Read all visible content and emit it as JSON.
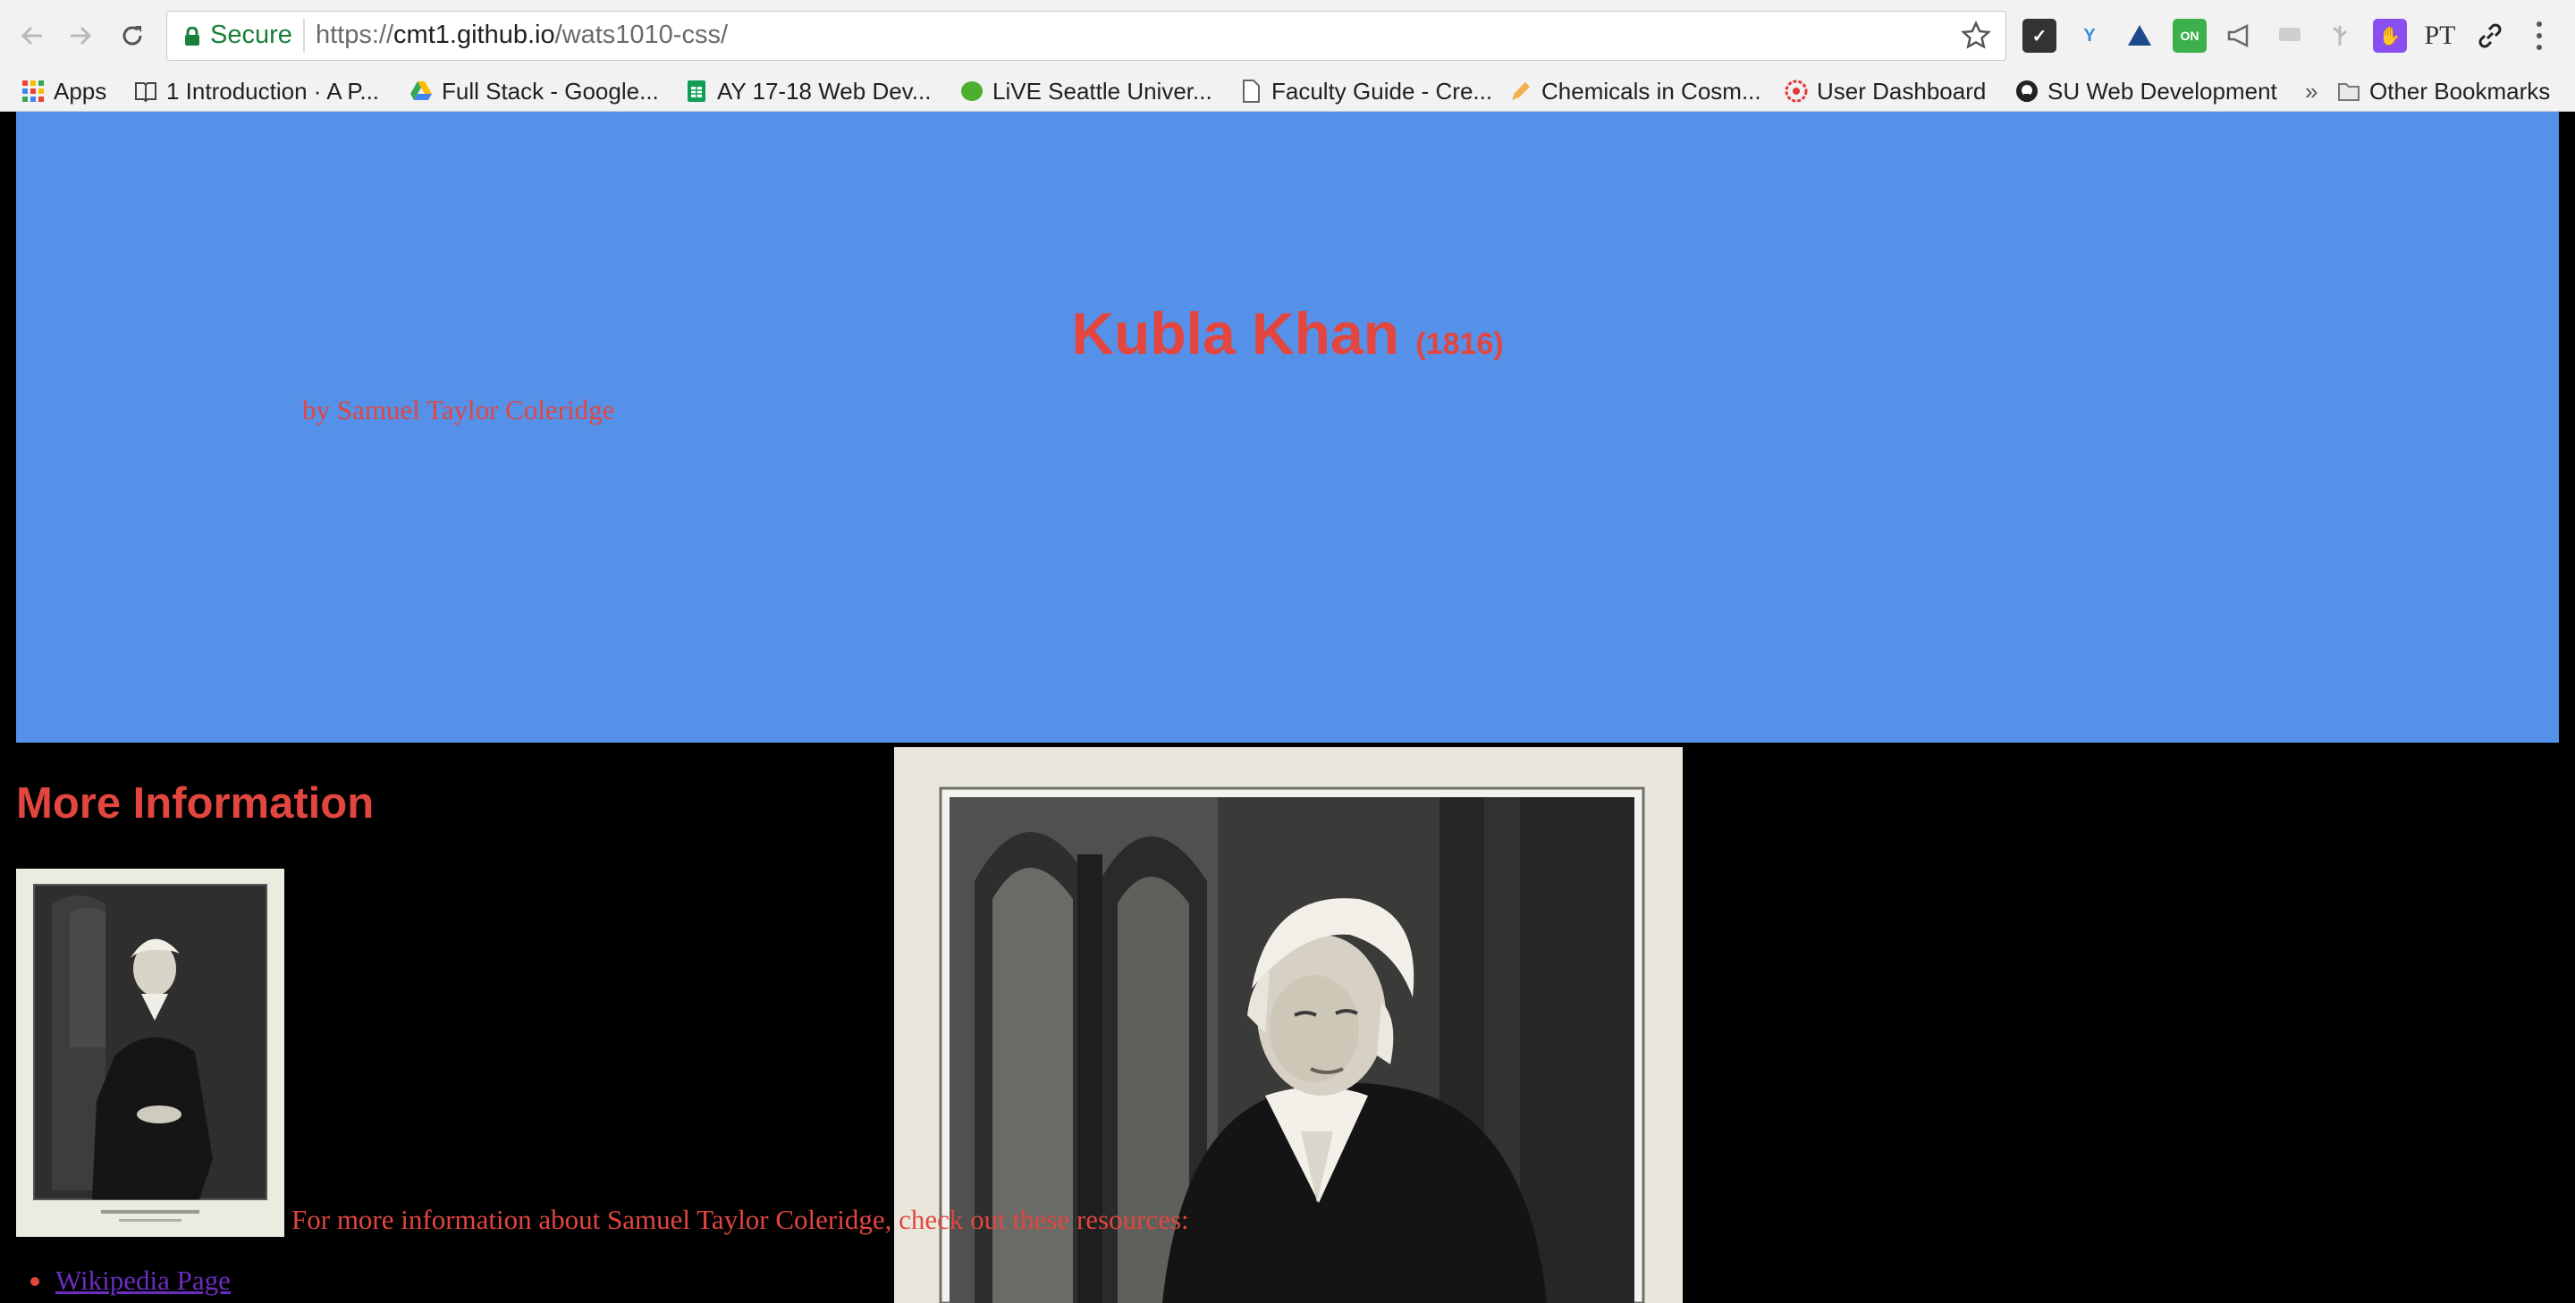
{
  "browser": {
    "secure_label": "Secure",
    "url_scheme": "https://",
    "url_host": "cmt1.github.io",
    "url_path": "/wats1010-css/",
    "bookmarks": [
      {
        "label": "Apps",
        "icon": "apps-grid-icon"
      },
      {
        "label": "1 Introduction · A P...",
        "icon": "book-icon"
      },
      {
        "label": "Full Stack - Google...",
        "icon": "google-drive-icon"
      },
      {
        "label": "AY 17-18 Web Dev...",
        "icon": "sheets-icon"
      },
      {
        "label": "LiVE Seattle Univer...",
        "icon": "leaf-icon"
      },
      {
        "label": "Faculty Guide - Cre...",
        "icon": "document-icon"
      },
      {
        "label": "Chemicals in Cosm...",
        "icon": "pencil-icon"
      },
      {
        "label": "User Dashboard",
        "icon": "dashboard-icon"
      },
      {
        "label": "SU Web Development",
        "icon": "github-icon"
      },
      {
        "label": "Other Bookmarks",
        "icon": "folder-icon"
      }
    ],
    "overflow_label": "»"
  },
  "page": {
    "title": "Kubla Khan",
    "year": "(1816)",
    "author": "by Samuel Taylor Coleridge",
    "more_heading": "More Information",
    "info_text": "For more information about Samuel Taylor Coleridge, check out these resources:",
    "links": [
      {
        "label": "Wikipedia Page"
      }
    ]
  },
  "colors": {
    "header_bg": "#5591e8",
    "text_red": "#e2463f",
    "page_bg": "#000000",
    "visited_link": "#6a2dbd"
  }
}
